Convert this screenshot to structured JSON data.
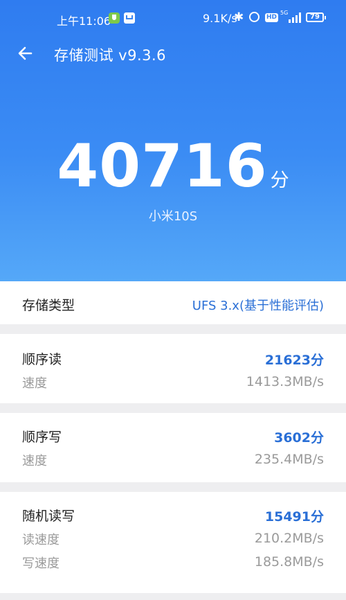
{
  "status": {
    "time": "上午11:06",
    "net_speed": "9.1K/s",
    "hd": "HD",
    "net_type": "5G",
    "battery": "79"
  },
  "header": {
    "title": "存储测试 v9.3.6"
  },
  "score": {
    "value": "40716",
    "unit": "分",
    "device": "小米10S"
  },
  "storage_type": {
    "label": "存储类型",
    "value": "UFS 3.x(基于性能评估)"
  },
  "sequential_read": {
    "label": "顺序读",
    "score": "21623分",
    "speed_label": "速度",
    "speed": "1413.3MB/s"
  },
  "sequential_write": {
    "label": "顺序写",
    "score": "3602分",
    "speed_label": "速度",
    "speed": "235.4MB/s"
  },
  "random_rw": {
    "label": "随机读写",
    "score": "15491分",
    "read_label": "读速度",
    "read_speed": "210.2MB/s",
    "write_label": "写速度",
    "write_speed": "185.8MB/s"
  },
  "colors": {
    "accent": "#2a6fd6",
    "hero_top": "#2f7cf0",
    "hero_bottom": "#55a8f8"
  }
}
